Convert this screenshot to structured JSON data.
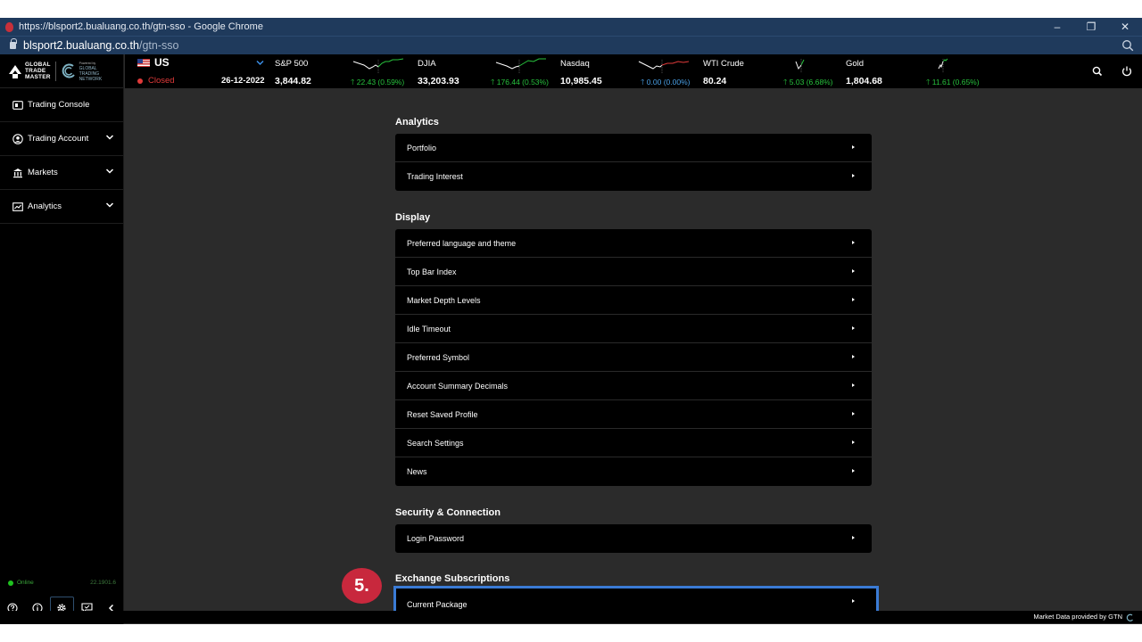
{
  "browser": {
    "window_title": "https://blsport2.bualuang.co.th/gtn-sso - Google Chrome",
    "url_host": "blsport2.bualuang.co.th",
    "url_path": "/gtn-sso",
    "controls": {
      "minimize": "–",
      "restore": "❐",
      "close": "✕"
    }
  },
  "brand": {
    "logo_line1": "GLOBAL",
    "logo_line2": "TRADE",
    "logo_line3": "MASTER",
    "partner_tag": "Powered by",
    "partner_line1": "GLOBAL",
    "partner_line2": "TRADING",
    "partner_line3": "NETWORK"
  },
  "sidebar": {
    "items": [
      {
        "label": "Trading Console",
        "icon": "console-icon",
        "expandable": false
      },
      {
        "label": "Trading Account",
        "icon": "account-icon",
        "expandable": true
      },
      {
        "label": "Markets",
        "icon": "bank-icon",
        "expandable": true
      },
      {
        "label": "Analytics",
        "icon": "analytics-icon",
        "expandable": true
      }
    ],
    "status": "Online",
    "version": "22.1901.6",
    "bottom_icons": [
      "help-icon",
      "info-icon",
      "settings-icon",
      "feedback-icon",
      "collapse-icon"
    ]
  },
  "ticker": {
    "market": "US",
    "market_status": "Closed",
    "date": "26-12-2022",
    "indices": [
      {
        "name": "S&P 500",
        "value": "3,844.82",
        "change": "22.43 (0.59%)",
        "direction": "up"
      },
      {
        "name": "DJIA",
        "value": "33,203.93",
        "change": "176.44 (0.53%)",
        "direction": "up"
      },
      {
        "name": "Nasdaq",
        "value": "10,985.45",
        "change": "0.00 (0.00%)",
        "direction": "flat"
      },
      {
        "name": "WTI Crude",
        "value": "80.24",
        "change": "5.03 (6.68%)",
        "direction": "up"
      },
      {
        "name": "Gold",
        "value": "1,804.68",
        "change": "11.61 (0.65%)",
        "direction": "up"
      }
    ]
  },
  "settings": {
    "sections": [
      {
        "title": "Analytics",
        "items": [
          "Portfolio",
          "Trading Interest"
        ]
      },
      {
        "title": "Display",
        "items": [
          "Preferred language and theme",
          "Top Bar Index",
          "Market Depth Levels",
          "Idle Timeout",
          "Preferred Symbol",
          "Account Summary Decimals",
          "Reset Saved Profile",
          "Search Settings",
          "News"
        ]
      },
      {
        "title": "Security & Connection",
        "items": [
          "Login Password"
        ]
      },
      {
        "title": "Exchange Subscriptions",
        "items": [
          "Current Package"
        ]
      }
    ],
    "highlighted_item": "Current Package",
    "step_badge": "5."
  },
  "footer": {
    "text": "Market Data provided by GTN"
  },
  "colors": {
    "accent": "#3a7bd5",
    "up": "#27c23d",
    "down": "#e03a3a",
    "flat": "#4aa0e6",
    "badge": "#c8283d"
  }
}
